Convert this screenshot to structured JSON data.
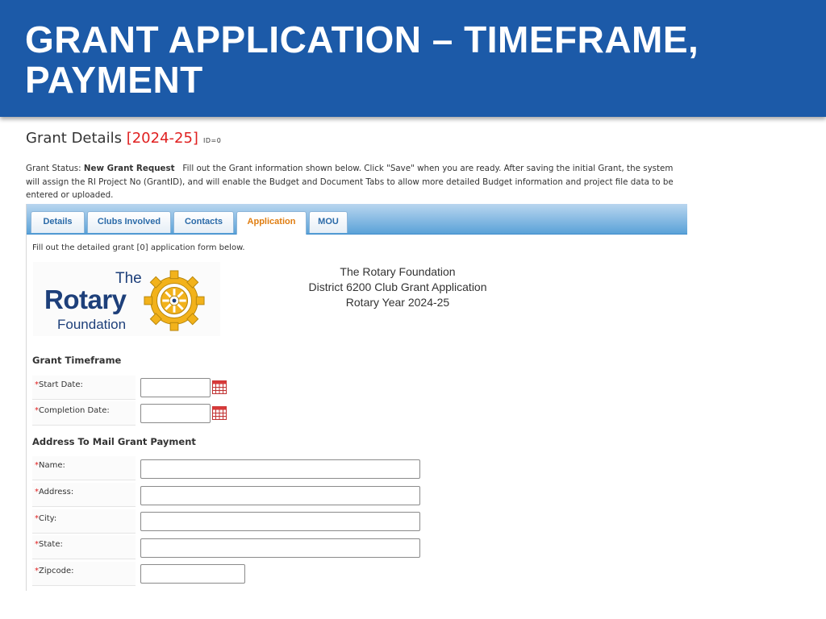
{
  "banner": {
    "title": "GRANT APPLICATION – TIMEFRAME, PAYMENT"
  },
  "grant_header": {
    "label": "Grant Details",
    "year": "[2024-25]",
    "id_text": "ID=0"
  },
  "status": {
    "prefix": "Grant Status:",
    "value": "New Grant Request",
    "message": "Fill out the Grant information shown below. Click \"Save\" when you are ready. After saving the initial Grant, the system will assign the RI Project No (GrantID), and will enable the Budget and Document Tabs to allow more detailed Budget information and project file data to be entered or uploaded."
  },
  "tabs": [
    {
      "label": "Details",
      "active": false
    },
    {
      "label": "Clubs Involved",
      "active": false
    },
    {
      "label": "Contacts",
      "active": false
    },
    {
      "label": "Application",
      "active": true
    },
    {
      "label": "MOU",
      "active": false
    }
  ],
  "instructions": "Fill out the detailed grant [0] application form below.",
  "logo": {
    "the": "The",
    "rotary": "Rotary",
    "foundation": "Foundation"
  },
  "foundation_heading": {
    "line1": "The Rotary Foundation",
    "line2": "District 6200 Club Grant Application",
    "line3": "Rotary Year 2024-25"
  },
  "timeframe": {
    "title": "Grant Timeframe",
    "start_date": {
      "label": "Start Date:",
      "value": ""
    },
    "completion_date": {
      "label": "Completion Date:",
      "value": ""
    }
  },
  "payment": {
    "title": "Address To Mail Grant Payment",
    "name": {
      "label": "Name:",
      "value": ""
    },
    "address": {
      "label": "Address:",
      "value": ""
    },
    "city": {
      "label": "City:",
      "value": ""
    },
    "state": {
      "label": "State:",
      "value": ""
    },
    "zipcode": {
      "label": "Zipcode:",
      "value": ""
    }
  },
  "required_marker": "*",
  "colors": {
    "banner": "#1c5aa8",
    "accent_red": "#e02020",
    "tab_active_text": "#e07d10",
    "tab_text": "#2a6aa8",
    "logo_blue": "#1d3f7a",
    "wheel_gold": "#f2b21b"
  },
  "icons": {
    "calendar": "calendar-icon",
    "wheel": "rotary-wheel-icon"
  }
}
